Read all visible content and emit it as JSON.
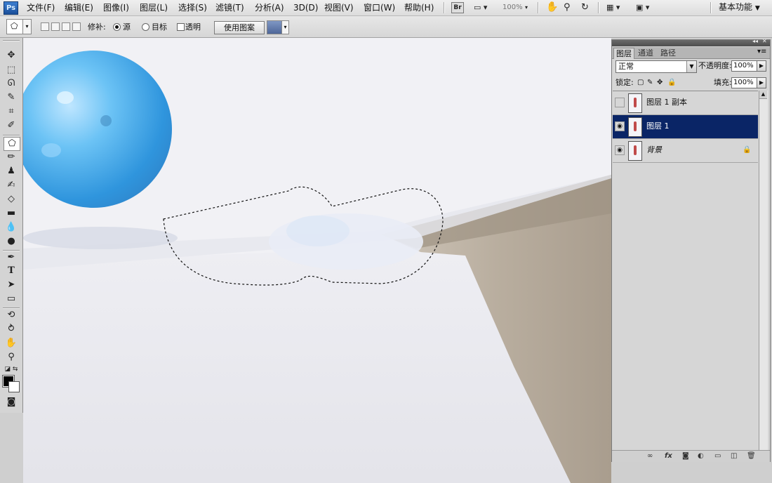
{
  "app": {
    "logo": "Ps",
    "workspace": "基本功能",
    "zoom": "100%",
    "bridge": "Br"
  },
  "menu": [
    "文件(F)",
    "编辑(E)",
    "图像(I)",
    "图层(L)",
    "选择(S)",
    "滤镜(T)",
    "分析(A)",
    "3D(D)",
    "视图(V)",
    "窗口(W)",
    "帮助(H)"
  ],
  "options": {
    "patch_label": "修补:",
    "source_label": "源",
    "destination_label": "目标",
    "transparent_label": "透明",
    "use_pattern_label": "使用图案",
    "patch_mode": "source"
  },
  "layers_panel": {
    "tabs": [
      "图层",
      "通道",
      "路径"
    ],
    "active_tab": 0,
    "blend_mode": "正常",
    "opacity_label": "不透明度:",
    "opacity_value": "100%",
    "lock_label": "锁定:",
    "fill_label": "填充:",
    "fill_value": "100%",
    "layers": [
      {
        "name": "图层 1 副本",
        "visible": false,
        "selected": false
      },
      {
        "name": "图层 1",
        "visible": true,
        "selected": true
      },
      {
        "name": "背景",
        "visible": true,
        "selected": false,
        "locked": true
      }
    ]
  },
  "colors": {
    "selection": "#0a2566",
    "balloon": "#3aa6e8",
    "canvas_bg": "#f0f0f4",
    "table": "#b3a898"
  }
}
